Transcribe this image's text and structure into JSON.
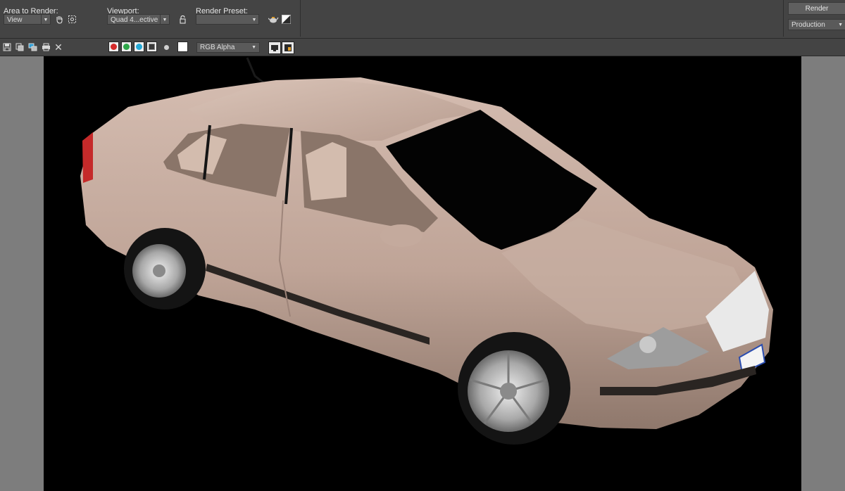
{
  "window": {
    "area_to_render": {
      "label": "Area to Render:",
      "value": "View"
    },
    "viewport": {
      "label": "Viewport:",
      "value": "Quad 4...ective"
    },
    "render_preset": {
      "label": "Render Preset:",
      "value": ""
    },
    "render_button": "Render",
    "render_mode": "Production"
  },
  "toolbar": {
    "channel_display": "RGB Alpha",
    "channels": [
      {
        "name": "red",
        "color": "#d42a2a"
      },
      {
        "name": "green",
        "color": "#2fa84a"
      },
      {
        "name": "blue",
        "color": "#25a9d6"
      }
    ]
  },
  "render_image": {
    "subject": "car-3d-render",
    "background": "#000000",
    "body_color": "#c6ada0"
  },
  "icons": [
    "save-icon",
    "copy-icon",
    "clone-window-icon",
    "print-icon",
    "close-icon",
    "hand-pan-icon",
    "region-select-icon",
    "lock-icon",
    "teapot-render-icon",
    "exposure-icon"
  ]
}
